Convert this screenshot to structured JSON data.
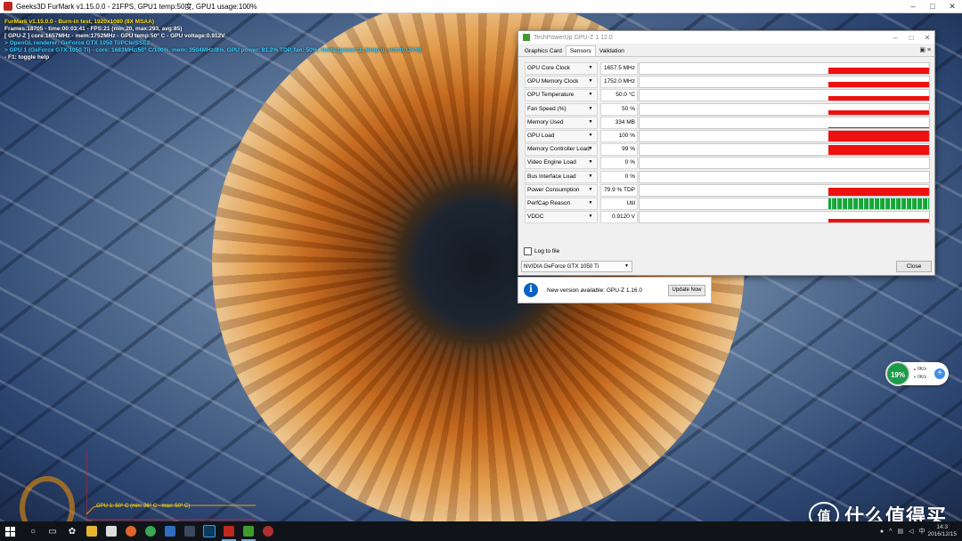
{
  "furmark": {
    "window_title": "Geeks3D FurMark v1.15.0.0 - 21FPS, GPU1 temp:50度, GPU1 usage:100%",
    "osd_lines": [
      "FurMark v1.15.0.0 - Burn-in test, 1920x1080 (8X MSAA)",
      "Frames:18705 - time:00:03:41 - FPS:21 (min:20, max:293, avg:85)",
      "[ GPU-Z ] core:1657MHz - mem:1752MHz - GPU temp:50° C - GPU voltage:0.912V",
      "> OpenGL renderer: GeForce GTX 1050 Ti/PCIe/SSE2",
      "> GPU 1 (GeForce GTX 1050 Ti) - core: 1683MHz/50° C/100%, mem: 3504MHz/8%, GPU power: 81.2% TDP, fan: 50%, limits:[power:1, temp:0, volt:0, OV:0]",
      "- F1: toggle help"
    ],
    "temp_graph_label": "GPU 1: 50° C (min: 26° C - max: 50° C)"
  },
  "gpuz": {
    "title": "TechPowerUp GPU-Z 1.12.0",
    "tabs": [
      "Graphics Card",
      "Sensors",
      "Validation"
    ],
    "active_tab": "Sensors",
    "sensors": [
      {
        "name": "GPU Core Clock",
        "value": "1657.5 MHz",
        "level": 0.62
      },
      {
        "name": "GPU Memory Clock",
        "value": "1752.0 MHz",
        "level": 0.55
      },
      {
        "name": "GPU Temperature",
        "value": "50.0 °C",
        "level": 0.45
      },
      {
        "name": "Fan Speed (%)",
        "value": "50 %",
        "level": 0.4
      },
      {
        "name": "Memory Used",
        "value": "334 MB",
        "level": 0.1
      },
      {
        "name": "GPU Load",
        "value": "100 %",
        "level": 1.0
      },
      {
        "name": "Memory Controller Load",
        "value": "99 %",
        "level": 0.9
      },
      {
        "name": "Video Engine Load",
        "value": "0 %",
        "level": 0
      },
      {
        "name": "Bus Interface Load",
        "value": "0 %",
        "level": 0
      },
      {
        "name": "Power Consumption",
        "value": "79.9 % TDP",
        "level": 0.75
      },
      {
        "name": "PerfCap Reason",
        "value": "Util",
        "level": 1.0
      },
      {
        "name": "VDDC",
        "value": "0.9120 V",
        "level": 0.35
      }
    ],
    "log_to_file": "Log to file",
    "gpu_select": "NVIDIA GeForce GTX 1050 Ti",
    "close_button": "Close",
    "notification": {
      "text": "New version available: GPU-Z 1.16.0",
      "button": "Update Now"
    }
  },
  "speed_widget": {
    "percent": "19%",
    "upload": "0K/s",
    "download": "0K/s"
  },
  "taskbar": {
    "time": "14:3",
    "date": "2016/12/15"
  },
  "watermark": {
    "text": "什么值得买",
    "mark": "值"
  },
  "colors": {
    "graph_red": "#ef1010",
    "graph_green": "#15a33a",
    "osd_yellow": "#ffe200",
    "osd_cyan": "#35d1ff"
  }
}
